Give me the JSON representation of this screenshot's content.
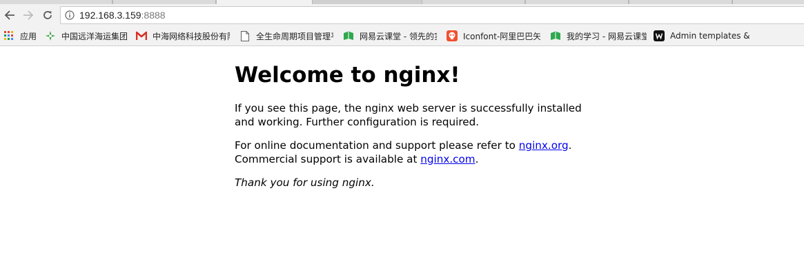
{
  "address_bar": {
    "url_host": "192.168.3.159",
    "url_port": ":8888"
  },
  "bookmarks": [
    {
      "label": "应用",
      "icon": "apps-grid-icon"
    },
    {
      "label": "中国远洋海运集团",
      "icon": "cosco-logo-icon"
    },
    {
      "label": "中海网络科技股份有限",
      "icon": "gmail-m-icon"
    },
    {
      "label": "全生命周期项目管理平",
      "icon": "page-icon"
    },
    {
      "label": "网易云课堂 - 领先的实",
      "icon": "study-book-icon"
    },
    {
      "label": "Iconfont-阿里巴巴矢",
      "icon": "iconfont-skull-icon"
    },
    {
      "label": "我的学习 - 网易云课堂",
      "icon": "study-book-icon"
    },
    {
      "label": "Admin templates &",
      "icon": "w-logo-icon"
    }
  ],
  "page": {
    "title": "Welcome to nginx!",
    "p1": "If you see this page, the nginx web server is successfully installed and working. Further configuration is required.",
    "p2_prefix": "For online documentation and support please refer to ",
    "link1": "nginx.org",
    "p2_mid": ".",
    "p2_line2_prefix": "Commercial support is available at ",
    "link2": "nginx.com",
    "p2_suffix": ".",
    "thanks": "Thank you for using nginx."
  },
  "colors": {
    "link": "#0000ee",
    "chrome_bg": "#f2f2f2",
    "port_text": "#7a7a7a"
  }
}
